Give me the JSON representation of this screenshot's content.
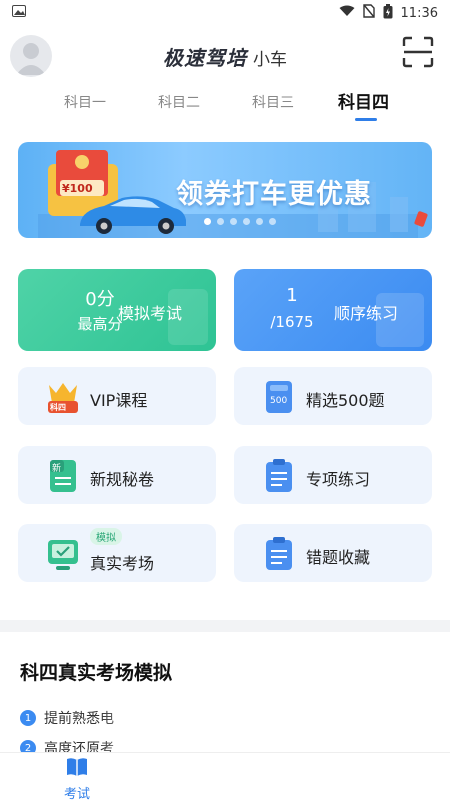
{
  "status": {
    "time": "11:36"
  },
  "header": {
    "title": "极速驾培",
    "subtitle": "小车"
  },
  "tabs": [
    {
      "label": "科目一"
    },
    {
      "label": "科目二"
    },
    {
      "label": "科目三"
    },
    {
      "label": "科目四"
    }
  ],
  "banner": {
    "text": "领券打车更优惠",
    "coupon": "¥100",
    "slide_count": 6,
    "active_slide": 0
  },
  "cards": {
    "score": {
      "value": "0分",
      "sub": "最高分",
      "action": "模拟考试"
    },
    "progress": {
      "value": "1",
      "sub": "/1675",
      "action": "顺序练习"
    },
    "vip": {
      "label": "VIP课程",
      "icon_text": "科四"
    },
    "selected": {
      "label": "精选500题",
      "icon_text": "500"
    },
    "new_rules": {
      "label": "新规秘卷",
      "icon_text": "新"
    },
    "special": {
      "label": "专项练习"
    },
    "real_exam": {
      "label": "真实考场",
      "badge": "模拟"
    },
    "mistakes": {
      "label": "错题收藏"
    }
  },
  "section": {
    "title": "科四真实考场模拟",
    "items": [
      {
        "num": "1",
        "text": "提前熟悉电"
      },
      {
        "num": "2",
        "text": "高度还原考"
      }
    ]
  },
  "bottom_nav": {
    "label": "考试"
  },
  "colors": {
    "accent": "#2f7ee8",
    "green": "#2ec394",
    "blue": "#3b8bf1",
    "card_bg": "#eef4fd"
  }
}
